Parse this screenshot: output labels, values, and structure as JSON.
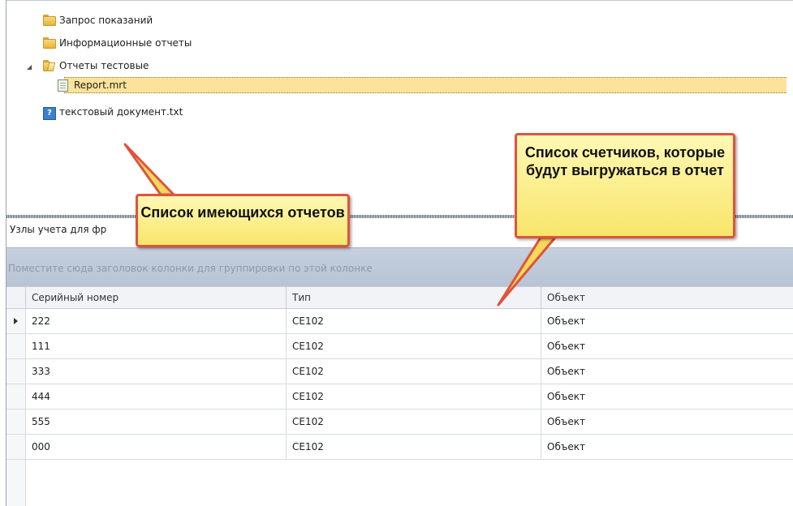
{
  "tree": {
    "items": [
      {
        "label": "Запрос показаний",
        "icon": "folder-icon"
      },
      {
        "label": "Информационные отчеты",
        "icon": "folder-icon"
      },
      {
        "label": "Отчеты тестовые",
        "icon": "folder-open-icon",
        "expanded": true
      },
      {
        "label": "Report.mrt",
        "icon": "report-file-icon",
        "selected": true
      },
      {
        "label": "текстовый документ.txt",
        "icon": "text-file-icon"
      }
    ]
  },
  "grid": {
    "panel_title": "Узлы учета для фр",
    "group_hint": "Поместите сюда заголовок колонки для группировки по этой колонке",
    "columns": [
      "Серийный номер",
      "Тип",
      "Объект"
    ],
    "rows": [
      {
        "serial": "222",
        "type": "CE102",
        "object": "Объект",
        "current": true
      },
      {
        "serial": "111",
        "type": "CE102",
        "object": "Объект"
      },
      {
        "serial": "333",
        "type": "CE102",
        "object": "Объект"
      },
      {
        "serial": "444",
        "type": "CE102",
        "object": "Объект"
      },
      {
        "serial": "555",
        "type": "CE102",
        "object": "Объект"
      },
      {
        "serial": "000",
        "type": "CE102",
        "object": "Объект"
      }
    ]
  },
  "callouts": {
    "reports": "Список имеющихся отчетов",
    "meters": "Список счетчиков, которые будут выгружаться в отчет"
  },
  "colors": {
    "selection": "#fbe39b",
    "callout_fill": "#f7e66a",
    "callout_border": "#e0533e",
    "group_panel": "#c0cad9"
  }
}
